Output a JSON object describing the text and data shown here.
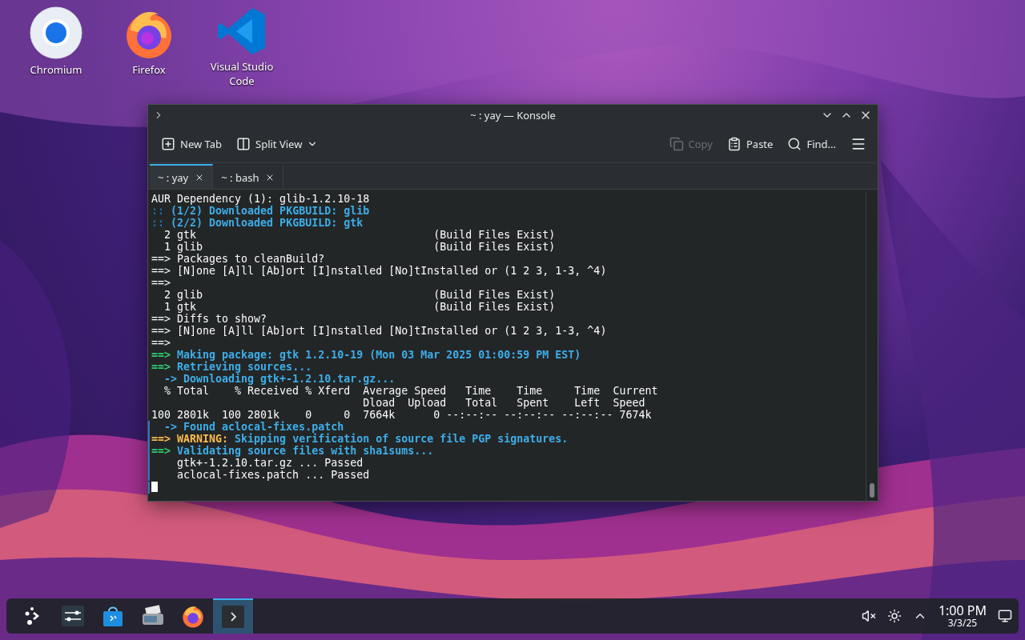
{
  "desktop_icons": [
    {
      "kind": "chromium",
      "label": "Chromium"
    },
    {
      "kind": "firefox",
      "label": "Firefox"
    },
    {
      "kind": "vscode",
      "label": "Visual Studio Code"
    }
  ],
  "window": {
    "title": "~ : yay — Konsole"
  },
  "toolbar": {
    "left": [
      {
        "kind": "new-tab",
        "label": "New Tab",
        "disabled": false
      },
      {
        "kind": "split-view",
        "label": "Split View",
        "disabled": false
      }
    ],
    "right": [
      {
        "kind": "copy",
        "label": "Copy",
        "disabled": true
      },
      {
        "kind": "paste",
        "label": "Paste",
        "disabled": false
      },
      {
        "kind": "find",
        "label": "Find...",
        "disabled": false
      }
    ]
  },
  "tabs": [
    {
      "label": "~ : yay",
      "selected": true
    },
    {
      "label": "~ : bash",
      "selected": false
    }
  ],
  "terminal": {
    "lines": [
      {
        "marked": false,
        "segments": [
          {
            "text": "AUR Dependency (1): glib-1.2.10-18",
            "color": "#fcfcfc",
            "bold": false
          }
        ]
      },
      {
        "marked": false,
        "segments": [
          {
            "text": ":: ",
            "color": "#1b6fa8",
            "bold": true
          },
          {
            "text": "(1/2) Downloaded PKGBUILD: glib",
            "color": "#3daee9",
            "bold": true
          }
        ]
      },
      {
        "marked": false,
        "segments": [
          {
            "text": ":: ",
            "color": "#1b6fa8",
            "bold": true
          },
          {
            "text": "(2/2) Downloaded PKGBUILD: gtk",
            "color": "#3daee9",
            "bold": true
          }
        ]
      },
      {
        "marked": false,
        "segments": [
          {
            "text": "  2 gtk                                     (Build Files Exist)",
            "color": "#fcfcfc",
            "bold": false
          }
        ]
      },
      {
        "marked": false,
        "segments": [
          {
            "text": "  1 glib                                    (Build Files Exist)",
            "color": "#fcfcfc",
            "bold": false
          }
        ]
      },
      {
        "marked": false,
        "segments": [
          {
            "text": "==> Packages to cleanBuild?",
            "color": "#fcfcfc",
            "bold": false
          }
        ]
      },
      {
        "marked": false,
        "segments": [
          {
            "text": "==> [N]one [A]ll [Ab]ort [I]nstalled [No]tInstalled or (1 2 3, 1-3, ^4)",
            "color": "#fcfcfc",
            "bold": false
          }
        ]
      },
      {
        "marked": false,
        "segments": [
          {
            "text": "==>",
            "color": "#fcfcfc",
            "bold": false
          }
        ]
      },
      {
        "marked": false,
        "segments": [
          {
            "text": "  2 glib                                    (Build Files Exist)",
            "color": "#fcfcfc",
            "bold": false
          }
        ]
      },
      {
        "marked": false,
        "segments": [
          {
            "text": "  1 gtk                                     (Build Files Exist)",
            "color": "#fcfcfc",
            "bold": false
          }
        ]
      },
      {
        "marked": false,
        "segments": [
          {
            "text": "==> Diffs to show?",
            "color": "#fcfcfc",
            "bold": false
          }
        ]
      },
      {
        "marked": false,
        "segments": [
          {
            "text": "==> [N]one [A]ll [Ab]ort [I]nstalled [No]tInstalled or (1 2 3, 1-3, ^4)",
            "color": "#fcfcfc",
            "bold": false
          }
        ]
      },
      {
        "marked": false,
        "segments": [
          {
            "text": "==>",
            "color": "#fcfcfc",
            "bold": false
          }
        ]
      },
      {
        "marked": false,
        "segments": [
          {
            "text": "==> ",
            "color": "#2ecc71",
            "bold": true
          },
          {
            "text": "Making package: gtk 1.2.10-19 (Mon 03 Mar 2025 01:00:59 PM EST)",
            "color": "#3daee9",
            "bold": true
          }
        ]
      },
      {
        "marked": false,
        "segments": [
          {
            "text": "==> ",
            "color": "#2ecc71",
            "bold": true
          },
          {
            "text": "Retrieving sources...",
            "color": "#3daee9",
            "bold": true
          }
        ]
      },
      {
        "marked": false,
        "segments": [
          {
            "text": "  -> Downloading gtk+-1.2.10.tar.gz...",
            "color": "#3daee9",
            "bold": true
          }
        ]
      },
      {
        "marked": false,
        "segments": [
          {
            "text": "  % Total    % Received % Xferd  Average Speed   Time    Time     Time  Current",
            "color": "#fcfcfc",
            "bold": false
          }
        ]
      },
      {
        "marked": false,
        "segments": [
          {
            "text": "                                 Dload  Upload   Total   Spent    Left  Speed",
            "color": "#fcfcfc",
            "bold": false
          }
        ]
      },
      {
        "marked": false,
        "segments": [
          {
            "text": "100 2801k  100 2801k    0     0  7664k      0 --:--:-- --:--:-- --:--:-- 7674k",
            "color": "#fcfcfc",
            "bold": false
          }
        ]
      },
      {
        "marked": true,
        "segments": [
          {
            "text": "  -> Found aclocal-fixes.patch",
            "color": "#3daee9",
            "bold": true
          }
        ]
      },
      {
        "marked": true,
        "segments": [
          {
            "text": "==> WARNING: ",
            "color": "#fdbc4b",
            "bold": true
          },
          {
            "text": "Skipping verification of source file PGP signatures.",
            "color": "#3daee9",
            "bold": true
          }
        ]
      },
      {
        "marked": true,
        "segments": [
          {
            "text": "==> ",
            "color": "#2ecc71",
            "bold": true
          },
          {
            "text": "Validating source files with sha1sums...",
            "color": "#3daee9",
            "bold": true
          }
        ]
      },
      {
        "marked": true,
        "segments": [
          {
            "text": "    gtk+-1.2.10.tar.gz ... Passed",
            "color": "#fcfcfc",
            "bold": false
          }
        ]
      },
      {
        "marked": true,
        "segments": [
          {
            "text": "    aclocal-fixes.patch ... Passed",
            "color": "#fcfcfc",
            "bold": false
          }
        ]
      }
    ]
  },
  "taskbar": {
    "apps": [
      {
        "kind": "launcher",
        "selected": false
      },
      {
        "kind": "settings",
        "selected": false
      },
      {
        "kind": "store",
        "selected": false
      },
      {
        "kind": "scanner",
        "selected": false
      },
      {
        "kind": "firefox",
        "selected": false
      },
      {
        "kind": "konsole",
        "selected": true
      }
    ],
    "tray": {
      "time": "1:00 PM",
      "date": "3/3/25"
    }
  }
}
